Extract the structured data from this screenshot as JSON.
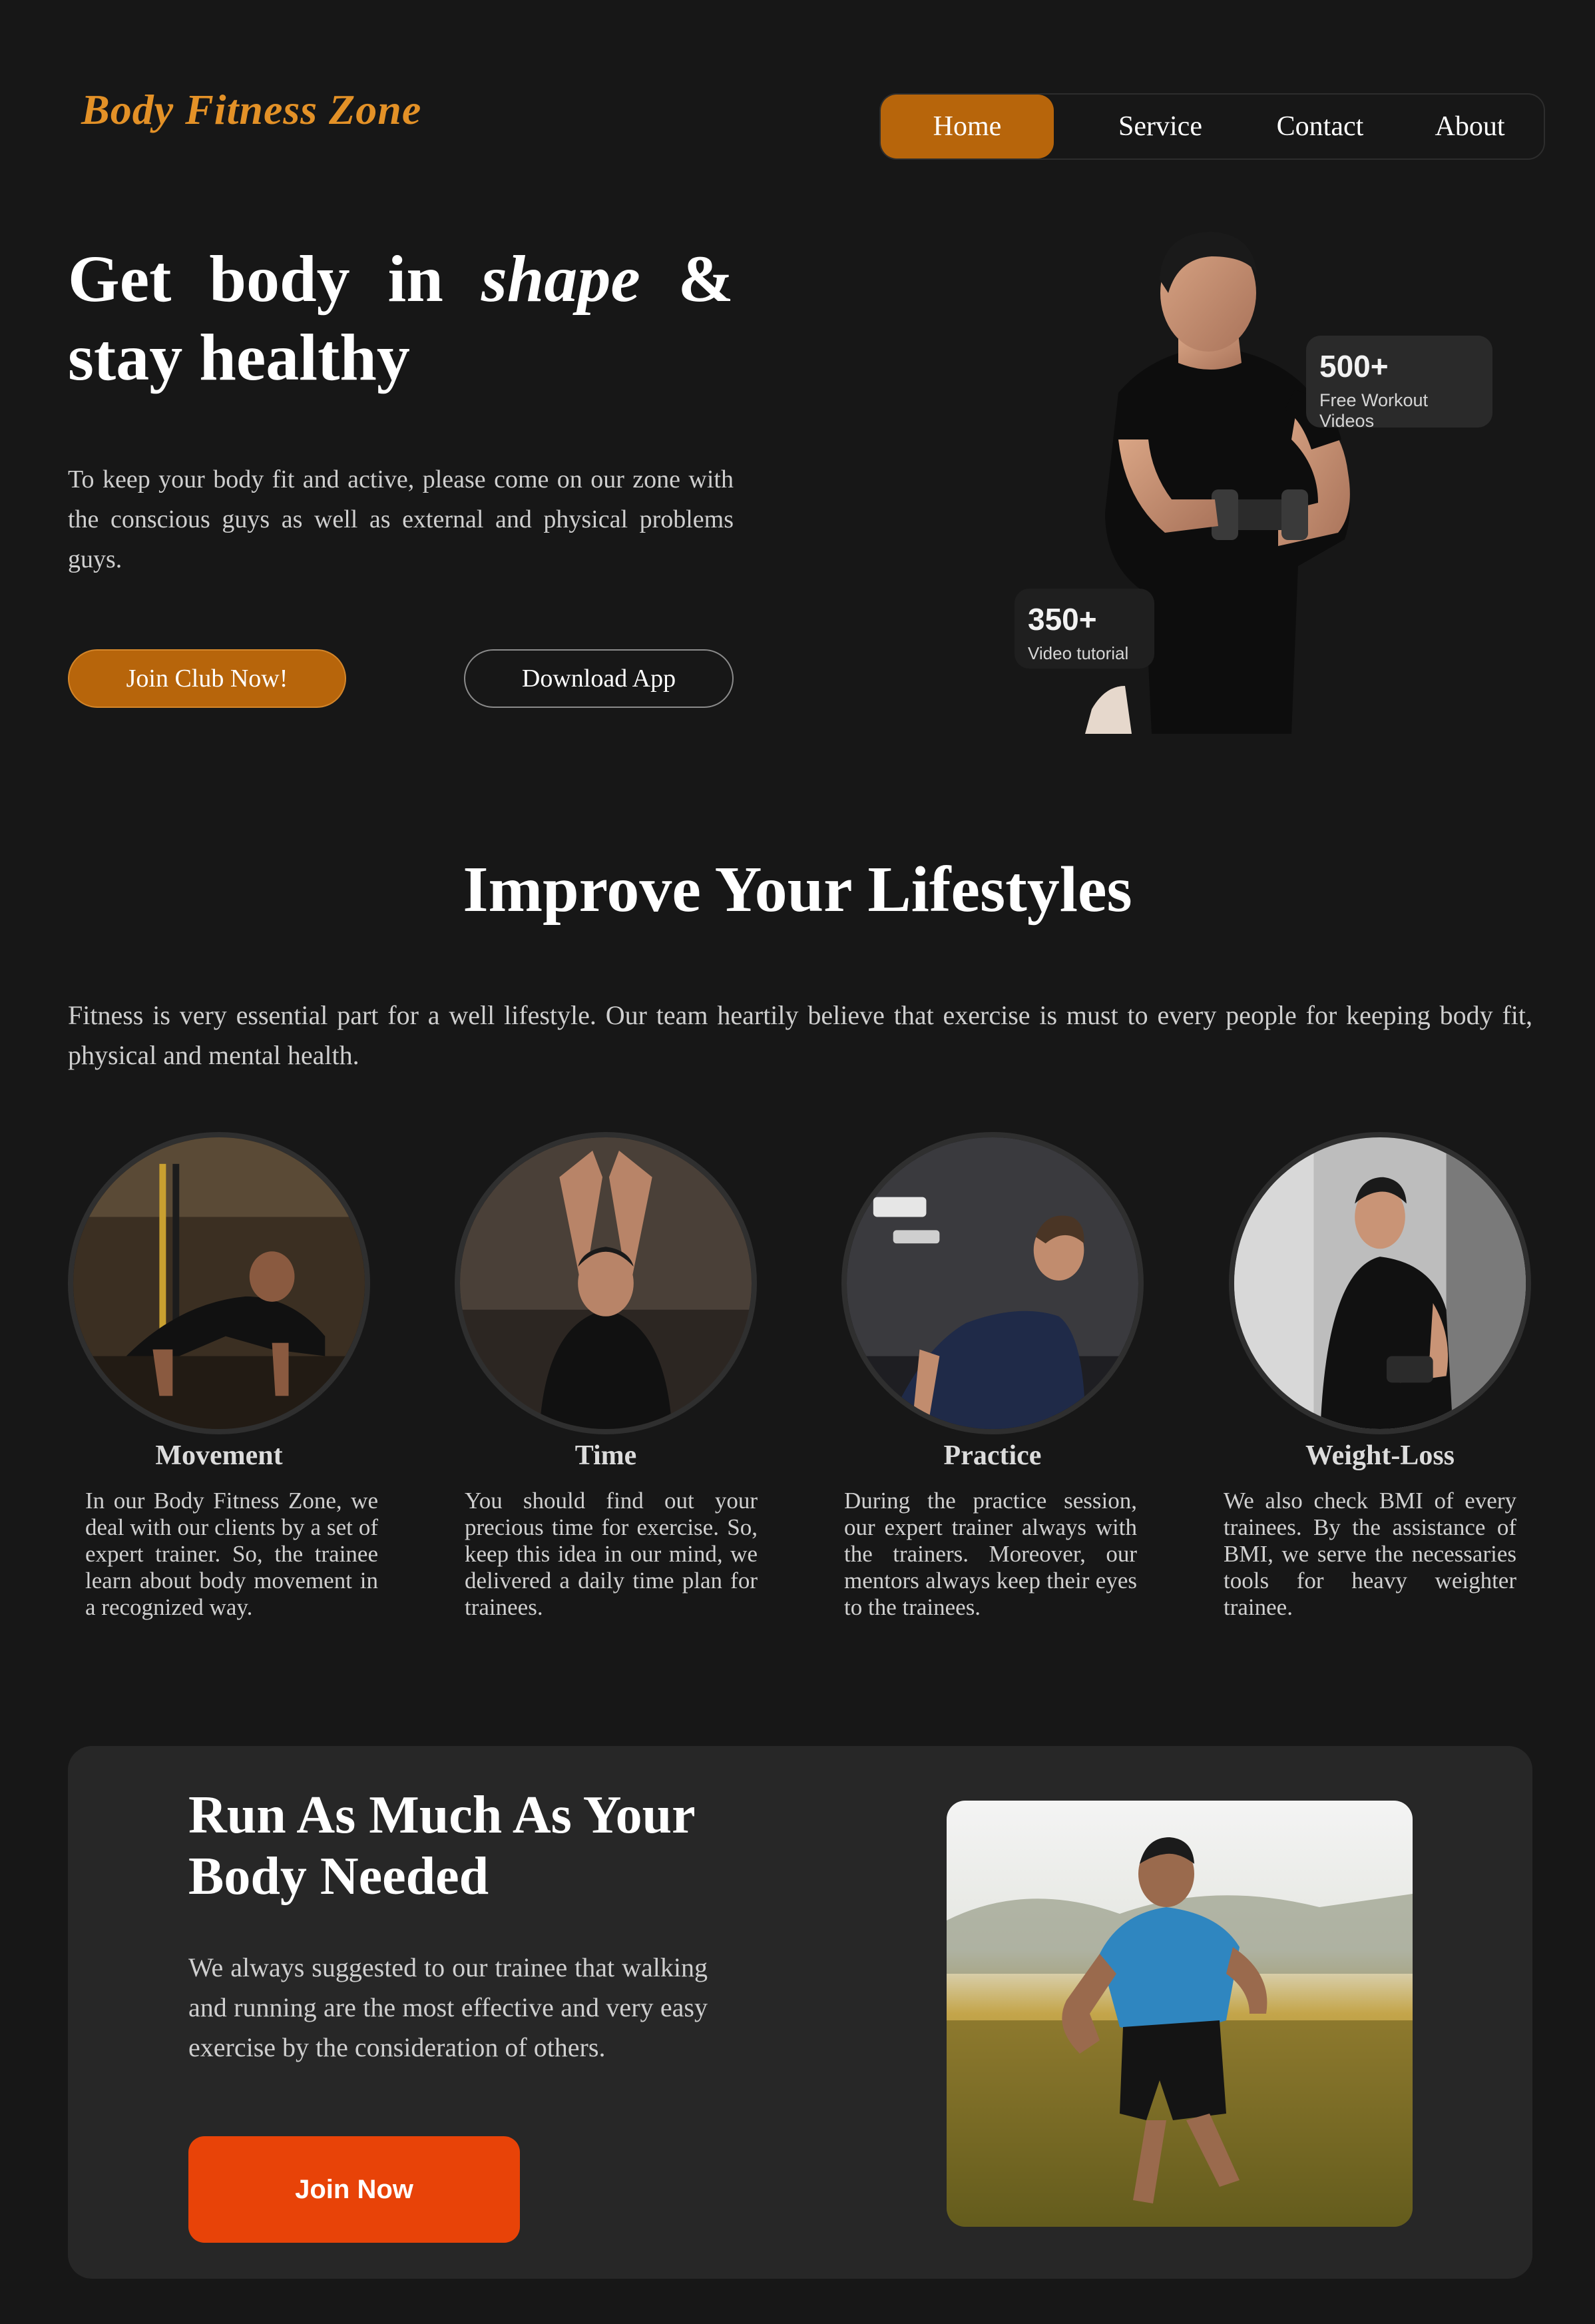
{
  "header": {
    "brand": "Body Fitness Zone",
    "nav": [
      {
        "label": "Home",
        "active": true
      },
      {
        "label": "Service",
        "active": false
      },
      {
        "label": "Contact",
        "active": false
      },
      {
        "label": "About",
        "active": false
      }
    ]
  },
  "hero": {
    "title_words_line1": [
      "Get",
      "body",
      "in",
      "shape",
      "&"
    ],
    "title_line2": "stay healthy",
    "description": "To keep your body fit and active, please come on our zone with the conscious guys as well as external and physical problems guys.",
    "join_button": "Join Club Now!",
    "download_button": "Download App",
    "stats": [
      {
        "value": "500+",
        "label": "Free Workout Videos"
      },
      {
        "value": "350+",
        "label": "Video tutorial"
      }
    ]
  },
  "lifestyle": {
    "title": "Improve Your Lifestyles",
    "description": "Fitness is very essential part for a well lifestyle. Our team heartily believe that exercise is must to every people for keeping body fit, physical and mental health.",
    "cards": [
      {
        "title": "Movement",
        "text": "In our Body Fitness Zone, we deal with our clients by a set of expert trainer. So, the trainee learn about body movement in a recognized way."
      },
      {
        "title": "Time",
        "text": "You should find out your precious time for exercise. So, keep this idea in our mind, we delivered a daily time plan for trainees."
      },
      {
        "title": "Practice",
        "text": "During the practice session, our expert trainer always with the trainers. Moreover, our mentors always keep their eyes to the trainees."
      },
      {
        "title": "Weight-Loss",
        "text": "We also check BMI of every trainees. By the assistance of BMI, we serve the necessaries tools for heavy weighter trainee."
      }
    ]
  },
  "run": {
    "title": "Run As Much As Your Body Needed",
    "description": "We always suggested to our trainee that walking and running are the most effective and very easy exercise by the consideration of others.",
    "button": "Join Now"
  },
  "colors": {
    "background": "#171717",
    "brand": "#e39127",
    "accent": "#b7650b",
    "cta": "#e84308",
    "panel": "#272727"
  }
}
